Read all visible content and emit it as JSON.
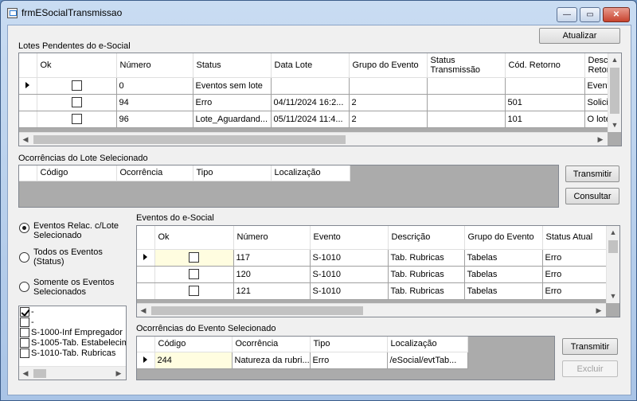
{
  "window": {
    "title": "frmESocialTransmissao",
    "min": "—",
    "max": "▭",
    "close": "✕"
  },
  "lotes": {
    "label": "Lotes Pendentes do e-Social",
    "headers": [
      "Ok",
      "Número",
      "Status",
      "Data Lote",
      "Grupo do Evento",
      "Status Transmissão",
      "Cód. Retorno",
      "Descr. Retorno"
    ],
    "rows": [
      {
        "numero": "0",
        "status": "Eventos sem lote",
        "data": "",
        "grupo": "",
        "status_tx": "",
        "cod": "",
        "desc": "Eventos"
      },
      {
        "numero": "94",
        "status": "Erro",
        "data": "04/11/2024 16:2...",
        "grupo": "2",
        "status_tx": "",
        "cod": "501",
        "desc": "Solicita"
      },
      {
        "numero": "96",
        "status": "Lote_Aguardand...",
        "data": "05/11/2024 11:4...",
        "grupo": "2",
        "status_tx": "",
        "cod": "101",
        "desc": "O lote"
      }
    ]
  },
  "atualizar": "Atualizar",
  "ocorr_lote": {
    "label": "Ocorrências do Lote Selecionado",
    "headers": [
      "Código",
      "Ocorrência",
      "Tipo",
      "Localização"
    ]
  },
  "btn_transmitir": "Transmitir",
  "btn_consultar": "Consultar",
  "radios": [
    {
      "label_l1": "Eventos Relac. c/Lote",
      "label_l2": "Selecionado",
      "checked": true
    },
    {
      "label_l1": "Todos os Eventos",
      "label_l2": "(Status)",
      "checked": false
    },
    {
      "label_l1": "Somente os Eventos",
      "label_l2": "Selecionados",
      "checked": false
    }
  ],
  "checklist": [
    {
      "label": "-",
      "checked": true
    },
    {
      "label": "-",
      "checked": false
    },
    {
      "label": "S-1000-Inf Empregador",
      "checked": false
    },
    {
      "label": "S-1005-Tab. Estabelecim",
      "checked": false
    },
    {
      "label": "S-1010-Tab. Rubricas",
      "checked": false
    }
  ],
  "eventos": {
    "label": "Eventos do e-Social",
    "headers": [
      "Ok",
      "Número",
      "Evento",
      "Descrição",
      "Grupo do Evento",
      "Status Atual"
    ],
    "rows": [
      {
        "numero": "117",
        "evento": "S-1010",
        "desc": "Tab. Rubricas",
        "grupo": "Tabelas",
        "status": "Erro"
      },
      {
        "numero": "120",
        "evento": "S-1010",
        "desc": "Tab. Rubricas",
        "grupo": "Tabelas",
        "status": "Erro"
      },
      {
        "numero": "121",
        "evento": "S-1010",
        "desc": "Tab. Rubricas",
        "grupo": "Tabelas",
        "status": "Erro"
      }
    ]
  },
  "ocorr_evento": {
    "label": "Ocorrências do Evento Selecionado",
    "headers": [
      "Código",
      "Ocorrência",
      "Tipo",
      "Localização"
    ],
    "rows": [
      {
        "codigo": "244",
        "ocorrencia": "Natureza da rubri...",
        "tipo": "Erro",
        "localizacao": "/eSocial/evtTab..."
      }
    ]
  },
  "btn_transmitir2": "Transmitir",
  "btn_excluir": "Excluir",
  "scroll": {
    "up": "▲",
    "down": "▼",
    "left": "◀",
    "right": "▶"
  }
}
